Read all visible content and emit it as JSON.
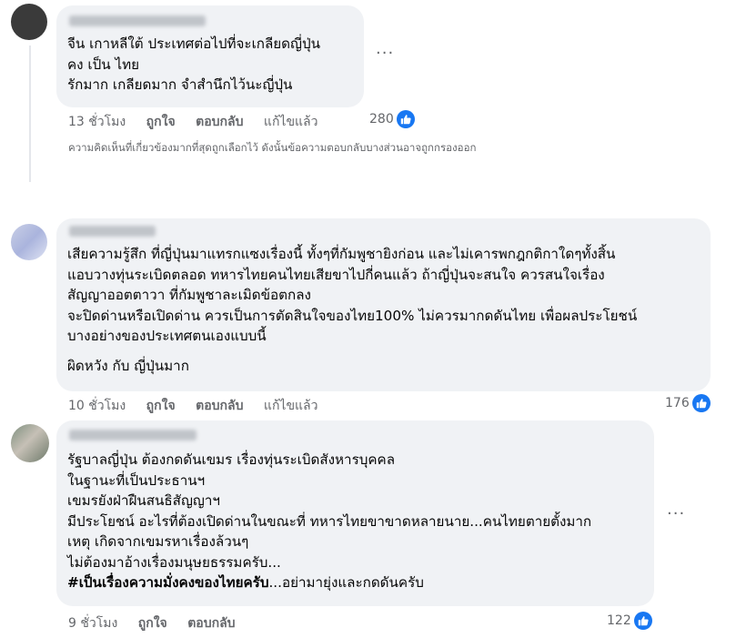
{
  "comments": [
    {
      "lines": [
        "จีน เกาหลีใต้ ประเทศต่อไปที่จะเกลียดญี่ปุ่น",
        "คง เป็น ไทย",
        "รักมาก เกลียดมาก จำสำนึกไว้นะญี่ปุ่น"
      ],
      "time": "13 ชั่วโมง",
      "like_label": "ถูกใจ",
      "reply_label": "ตอบกลับ",
      "edited_label": "แก้ไขแล้ว",
      "reaction_count": "280",
      "more_label": "···"
    },
    {
      "lines": [
        "เสียความรู้สึก ที่ญี่ปุ่นมาแทรกแซงเรื่องนี้ ทั้งๆที่กัมพูชายิงก่อน และไม่เคารพกฎกติกาใดๆทั้งสิ้น",
        "แอบวางทุ่นระเบิดตลอด ทหารไทยคนไทยเสียขาไปกี่คนแล้ว ถ้าญี่ปุ่นจะสนใจ ควรสนใจเรื่อง",
        "สัญญาออตตาวา ที่กัมพูชาละเมิดข้อตกลง",
        "จะปิดด่านหรือเปิดด่าน ควรเป็นการตัดสินใจของไทย100% ไม่ควรมากดดันไทย เพื่อผลประโยชน์",
        "บางอย่างของประเทศตนเองแบบนี้"
      ],
      "final_line": "ผิดหวัง กับ ญี่ปุ่นมาก",
      "time": "10 ชั่วโมง",
      "like_label": "ถูกใจ",
      "reply_label": "ตอบกลับ",
      "edited_label": "แก้ไขแล้ว",
      "reaction_count": "176"
    },
    {
      "lines": [
        "รัฐบาลญี่ปุ่น ต้องกดดันเขมร เรื่องทุ่นระเบิดสังหารบุคคล",
        "ในฐานะที่เป็นประธานฯ",
        "เขมรยังฝ่าฝืนสนธิสัญญาฯ",
        "มีประโยชน์ อะไรที่ต้องเปิดด่านในขณะที่ ทหารไทยขาขาดหลายนาย...คนไทยตายตั้งมาก",
        "เหตุ เกิดจากเขมรหาเรื่องล้วนๆ",
        "ไม่ต้องมาอ้างเรื่องมนุษยธรรมครับ..."
      ],
      "hashtag": "#เป็นเรื่องความมั่งคงของไทยครับ",
      "hashtag_rest": "...อย่ามายุ่งและกดดันครับ",
      "time": "9 ชั่วโมง",
      "like_label": "ถูกใจ",
      "reply_label": "ตอบกลับ",
      "reaction_count": "122",
      "more_label": "···"
    }
  ],
  "filter_note": "ความคิดเห็นที่เกี่ยวข้องมากที่สุดถูกเลือกไว้ ดังนั้นข้อความตอบกลับบางส่วนอาจถูกกรองออก",
  "colors": {
    "like_blue": "#1877f2",
    "bubble_bg": "#f0f2f5",
    "meta_gray": "#65676b"
  },
  "icons": [
    "avatar",
    "like-icon",
    "more-options-icon"
  ]
}
